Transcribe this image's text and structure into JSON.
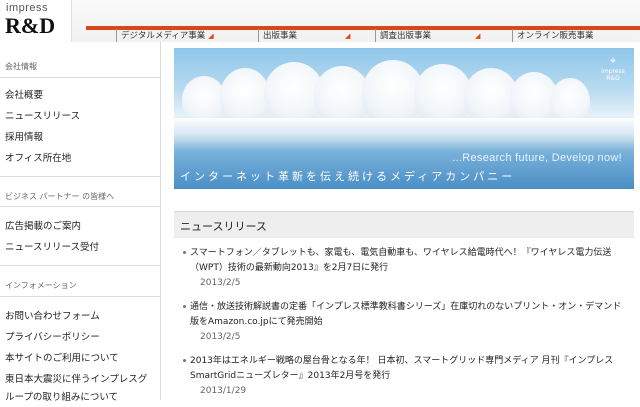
{
  "logo": {
    "line1": "impress",
    "line2": "R&D"
  },
  "topnav": [
    {
      "label": "デジタルメディア事業"
    },
    {
      "label": "出版事業"
    },
    {
      "label": "調査出版事業"
    },
    {
      "label": "オンライン販売事業"
    }
  ],
  "sidebar": {
    "sections": [
      {
        "title": "会社情報",
        "links": [
          "会社概要",
          "ニュースリリース",
          "採用情報",
          "オフィス所在地"
        ]
      },
      {
        "title": "ビジネス パートナー の皆様へ",
        "links": [
          "広告掲載のご案内",
          "ニュースリリース受付"
        ]
      },
      {
        "title": "インフォメーション",
        "links": [
          "お問い合わせフォーム",
          "プライバシーポリシー",
          "本サイトのご利用について",
          "東日本大震災に伴うインプレスグループの取り組みについて"
        ]
      }
    ]
  },
  "hero": {
    "tagline_en": "...Research future, Develop now!",
    "tagline_jp": "インターネット革新を伝え続けるメディアカンパニー",
    "mini_logo": "impress R&D"
  },
  "news": {
    "heading": "ニュースリリース",
    "items": [
      {
        "line1": "スマートフォン／タブレットも、家電も、電気自動車も、ワイヤレス給電時代へ！『ワイヤレス電力伝送",
        "line2": "（WPT）技術の最新動向2013』を2月7日に発行",
        "date": "2013/2/5"
      },
      {
        "line1": "通信・放送技術解説書の定番「インプレス標準教科書シリーズ」在庫切れのないプリント・オン・デマンド",
        "line2": "版をAmazon.co.jpにて発売開始",
        "date": "2013/2/5"
      },
      {
        "line1": "2013年はエネルギー戦略の屋台骨となる年！ 日本初、スマートグリッド専門メディア 月刊『インプレス",
        "line2": "SmartGridニューズレター』2013年2月号を発行",
        "date": "2013/1/29"
      }
    ]
  }
}
